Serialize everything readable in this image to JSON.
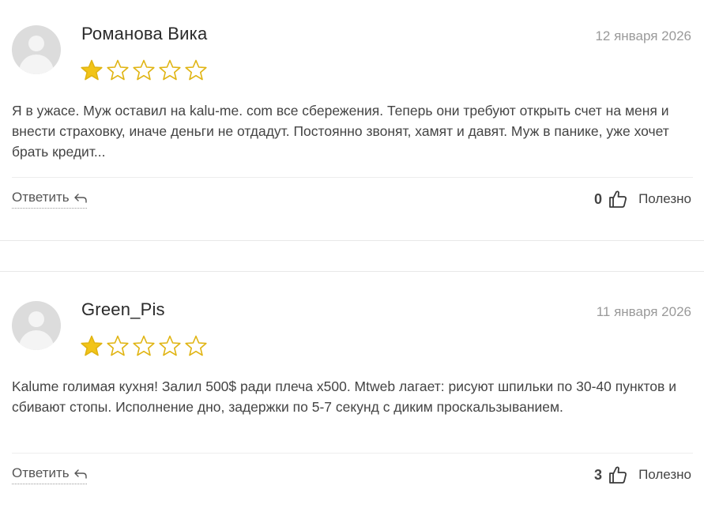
{
  "reviews": [
    {
      "author": "Романова Вика",
      "date": "12 января 2026",
      "rating": 1,
      "max_rating": 5,
      "text": "Я в ужасе. Муж оставил на kalu-me. com все сбережения. Теперь они требуют открыть счет на меня и внести страховку, иначе деньги не отдадут. Постоянно звонят, хамят и давят. Муж в панике, уже хочет брать кредит...",
      "reply_label": "Ответить",
      "helpful_count": "0",
      "helpful_label": "Полезно"
    },
    {
      "author": "Green_Pis",
      "date": "11 января 2026",
      "rating": 1,
      "max_rating": 5,
      "text": "Kalume голимая кухня! Залил 500$ ради плеча х500. Mtweb лагает: рисуют шпильки по 30-40 пунктов и сбивают стопы. Исполнение дно, задержки по 5-7 секунд с диким проскальзыванием.",
      "reply_label": "Ответить",
      "helpful_count": "3",
      "helpful_label": "Полезно"
    }
  ],
  "colors": {
    "star_fill": "#f2c418",
    "star_stroke": "#e0b412",
    "avatar_bg": "#dcdcdc",
    "date": "#9a9a9a",
    "divider": "#e8e8e8"
  },
  "icons": {
    "avatar": "user-silhouette-icon",
    "star": "star-icon",
    "reply": "reply-arrow-icon",
    "like": "thumbs-up-icon"
  }
}
